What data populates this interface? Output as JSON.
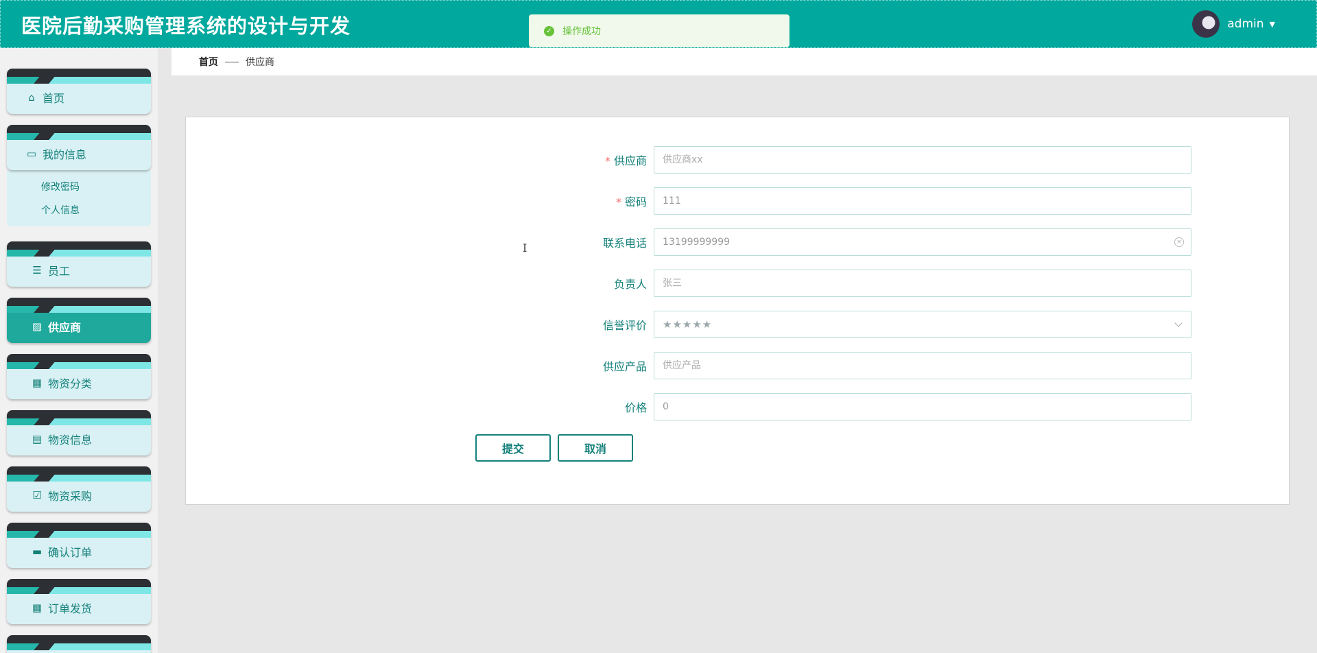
{
  "header": {
    "title": "医院后勤采购管理系统的设计与开发",
    "toast": "操作成功",
    "username": "admin"
  },
  "colors": {
    "primary": "#00a89d",
    "text_teal": "#13807a",
    "success": "#67c23a"
  },
  "sidebar": {
    "items": [
      {
        "label": "首页",
        "icon": "home-icon"
      },
      {
        "label": "我的信息",
        "icon": "wallet-icon",
        "children": [
          "修改密码",
          "个人信息"
        ]
      },
      {
        "label": "员工",
        "icon": "sliders-icon"
      },
      {
        "label": "供应商",
        "icon": "chart-icon",
        "active": true
      },
      {
        "label": "物资分类",
        "icon": "grid-icon"
      },
      {
        "label": "物资信息",
        "icon": "clipboard-icon"
      },
      {
        "label": "物资采购",
        "icon": "clipboard-check-icon"
      },
      {
        "label": "确认订单",
        "icon": "briefcase-icon"
      },
      {
        "label": "订单发货",
        "icon": "grid-icon"
      }
    ]
  },
  "breadcrumb": {
    "home": "首页",
    "current": "供应商"
  },
  "form": {
    "fields": [
      {
        "label": "供应商",
        "required": true,
        "placeholder": "供应商xx"
      },
      {
        "label": "密码",
        "required": true,
        "value": "111"
      },
      {
        "label": "联系电话",
        "required": false,
        "value": "13199999999"
      },
      {
        "label": "负责人",
        "required": false,
        "placeholder": "张三"
      },
      {
        "label": "信誉评价",
        "required": false,
        "value": "★★★★★"
      },
      {
        "label": "供应产品",
        "required": false,
        "placeholder": "供应产品"
      },
      {
        "label": "价格",
        "required": false,
        "value": "0"
      }
    ],
    "submit_label": "提交",
    "cancel_label": "取消"
  }
}
